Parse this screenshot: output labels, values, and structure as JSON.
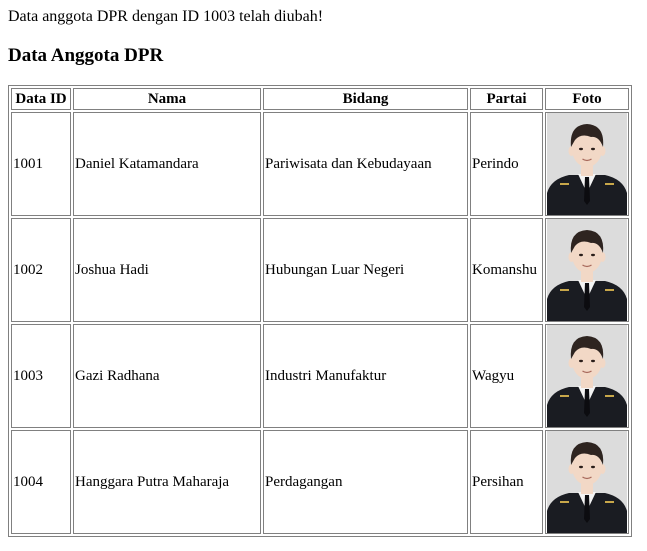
{
  "message": "Data anggota DPR dengan ID 1003 telah diubah!",
  "title": "Data Anggota DPR",
  "table": {
    "headers": [
      "Data ID",
      "Nama",
      "Bidang",
      "Partai",
      "Foto"
    ],
    "rows": [
      {
        "id": "1001",
        "nama": "Daniel Katamandara",
        "bidang": "Pariwisata dan Kebudayaan",
        "partai": "Perindo"
      },
      {
        "id": "1002",
        "nama": "Joshua Hadi",
        "bidang": "Hubungan Luar Negeri",
        "partai": "Komanshu"
      },
      {
        "id": "1003",
        "nama": "Gazi Radhana",
        "bidang": "Industri Manufaktur",
        "partai": "Wagyu"
      },
      {
        "id": "1004",
        "nama": "Hanggara Putra Maharaja",
        "bidang": "Perdagangan",
        "partai": "Persihan"
      }
    ]
  },
  "colors": {
    "border": "#808080",
    "photo_background": "#dcdcdc",
    "uniform": "#1a1c22",
    "hair": "#2e2420",
    "skin": "#f2d8c6"
  }
}
